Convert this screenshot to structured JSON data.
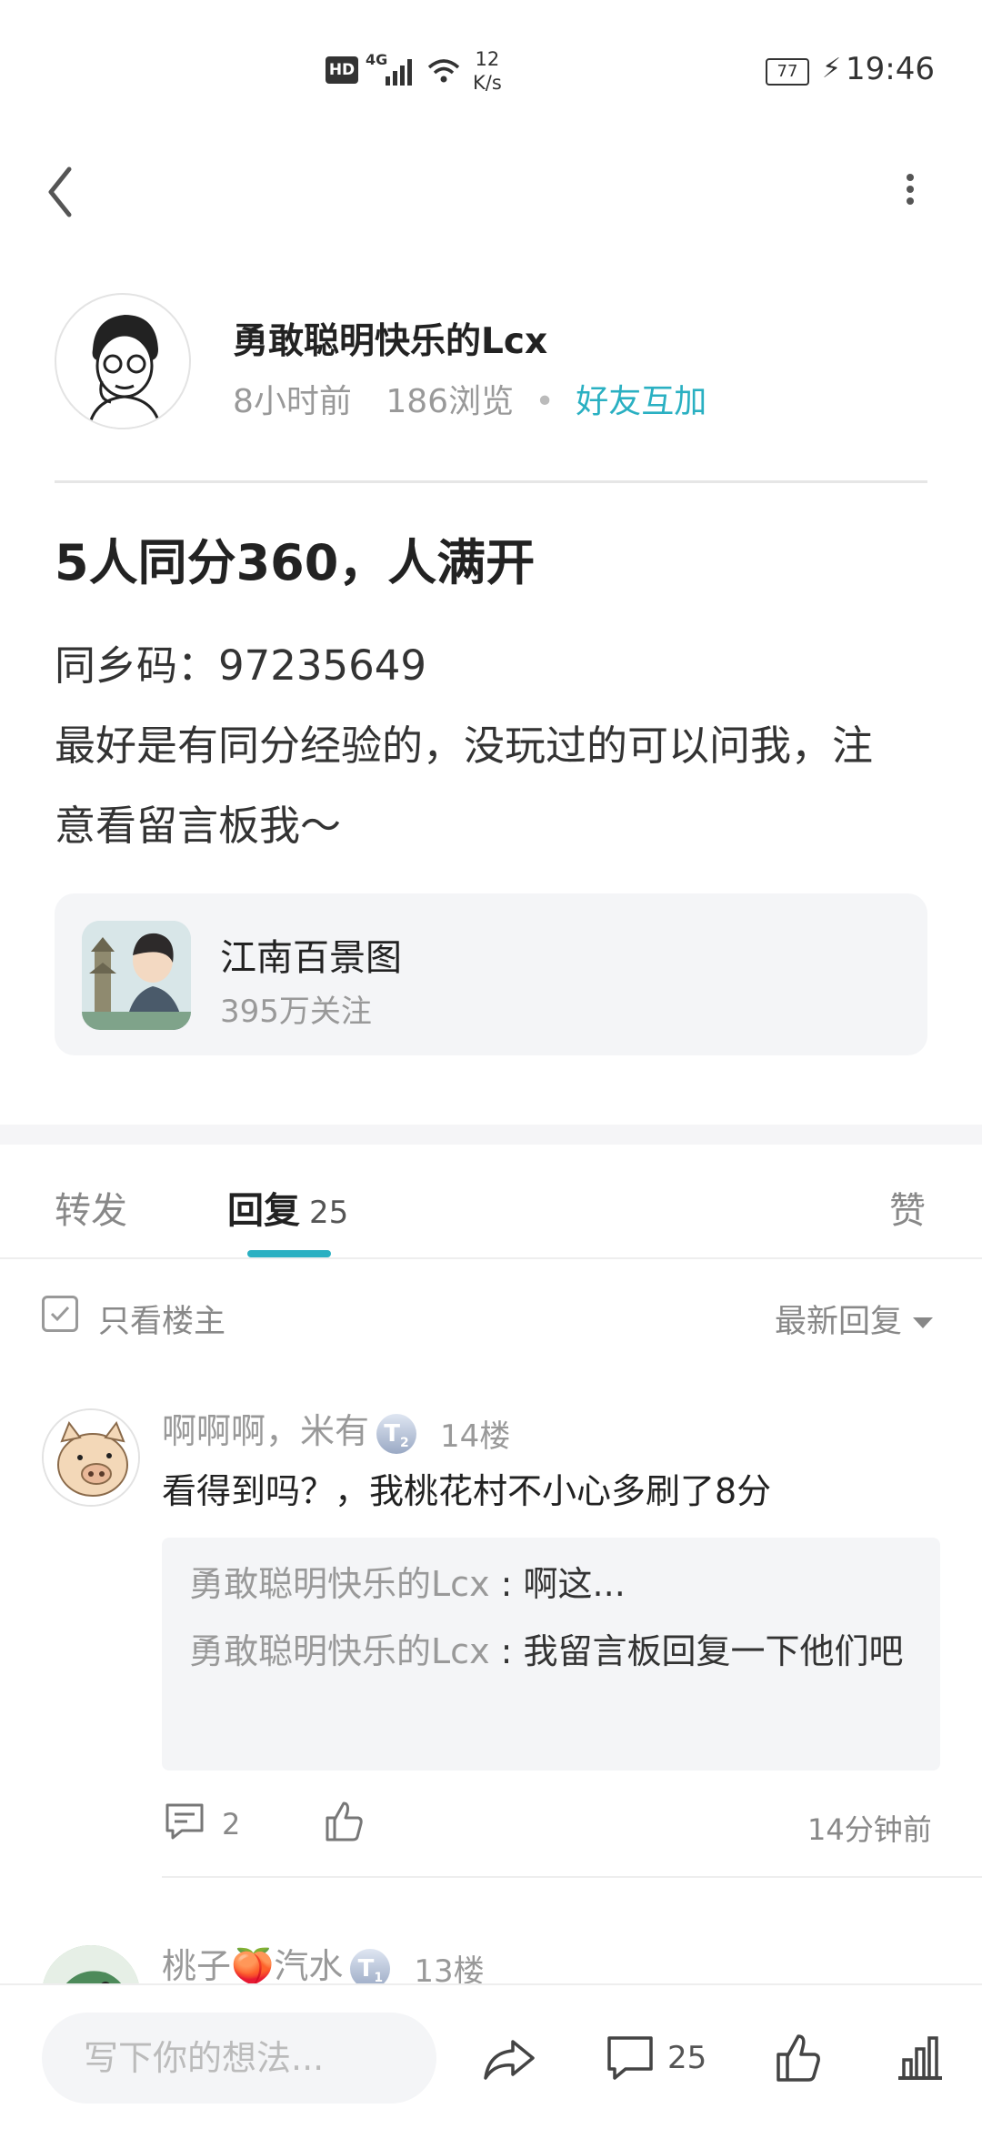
{
  "status_bar": {
    "hd": "HD",
    "network": "4G",
    "speed_value": "12",
    "speed_unit": "K/s",
    "battery": "77",
    "time": "19:46"
  },
  "post": {
    "author": "勇敢聪明快乐的Lcx",
    "time_ago": "8小时前",
    "views": "186浏览",
    "friend_tag": "好友互加",
    "title": "5人同分360，人满开",
    "body_lines": [
      "同乡码：97235649",
      "最好是有同分经验的，没玩过的可以问我，注",
      "意看留言板我～"
    ]
  },
  "topic": {
    "name": "江南百景图",
    "followers": "395万关注"
  },
  "tabs": {
    "forward": "转发",
    "reply": "回复",
    "reply_count": "25",
    "like": "赞"
  },
  "filter": {
    "only_owner": "只看楼主",
    "sort": "最新回复"
  },
  "comments": [
    {
      "user": "啊啊啊，米有",
      "level": "T",
      "level_num": "2",
      "floor": "14楼",
      "text": "看得到吗？，我桃花村不小心多刷了8分",
      "replies": [
        {
          "user": "勇敢聪明快乐的Lcx",
          "text": "啊这..."
        },
        {
          "user": "勇敢聪明快乐的Lcx",
          "text": "我留言板回复一下他们吧"
        }
      ],
      "reply_count": "2",
      "time": "14分钟前"
    },
    {
      "user": "桃子🍑汽水",
      "level": "T",
      "level_num": "1",
      "floor": "13楼"
    }
  ],
  "bottom_bar": {
    "placeholder": "写下你的想法...",
    "comment_count": "25"
  },
  "colors": {
    "accent": "#2ab0c2"
  }
}
